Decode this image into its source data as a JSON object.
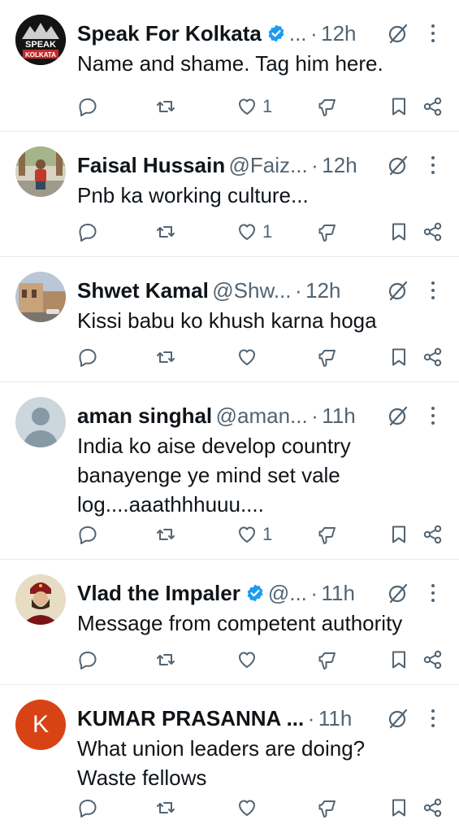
{
  "colors": {
    "text": "#0f1419",
    "secondary": "#536471",
    "verified": "#1d9bf0",
    "divider": "#e6e9ec"
  },
  "tweets": [
    {
      "name": "Speak For Kolkata",
      "verified": true,
      "handle": "...",
      "dot": "·",
      "time": "12h",
      "text": [
        "Name and shame. Tag him here."
      ],
      "likes": "1",
      "avatar": "speak-for-kolkata-logo",
      "avatar_text": [
        "SPEAK",
        "KOLKATA"
      ]
    },
    {
      "name": "Faisal Hussain",
      "verified": false,
      "handle": "@Faiz...",
      "dot": "·",
      "time": "12h",
      "text": [
        "Pnb ka working culture..."
      ],
      "likes": "1",
      "avatar": "person-photo"
    },
    {
      "name": "Shwet Kamal",
      "verified": false,
      "handle": "@Shw...",
      "dot": "·",
      "time": "12h",
      "text": [
        "Kissi babu ko khush karna hoga"
      ],
      "likes": "",
      "avatar": "building-photo"
    },
    {
      "name": "aman singhal",
      "verified": false,
      "handle": "@aman...",
      "dot": "·",
      "time": "11h",
      "text": [
        "India ko aise develop country",
        "banayenge ye mind set vale",
        "log....aaathhhuuu...."
      ],
      "likes": "1",
      "avatar": "default-avatar"
    },
    {
      "name": "Vlad the Impaler",
      "verified": true,
      "handle": "@...",
      "dot": "·",
      "time": "11h",
      "text": [
        "Message from competent authority"
      ],
      "likes": "",
      "avatar": "portrait-painting"
    },
    {
      "name": "KUMAR PRASANNA ...",
      "verified": false,
      "handle": "",
      "dot": "·",
      "time": "11h",
      "text": [
        "What union leaders are doing?",
        "Waste fellows"
      ],
      "likes": "",
      "avatar": "letter-avatar",
      "avatar_letter": "K"
    }
  ]
}
